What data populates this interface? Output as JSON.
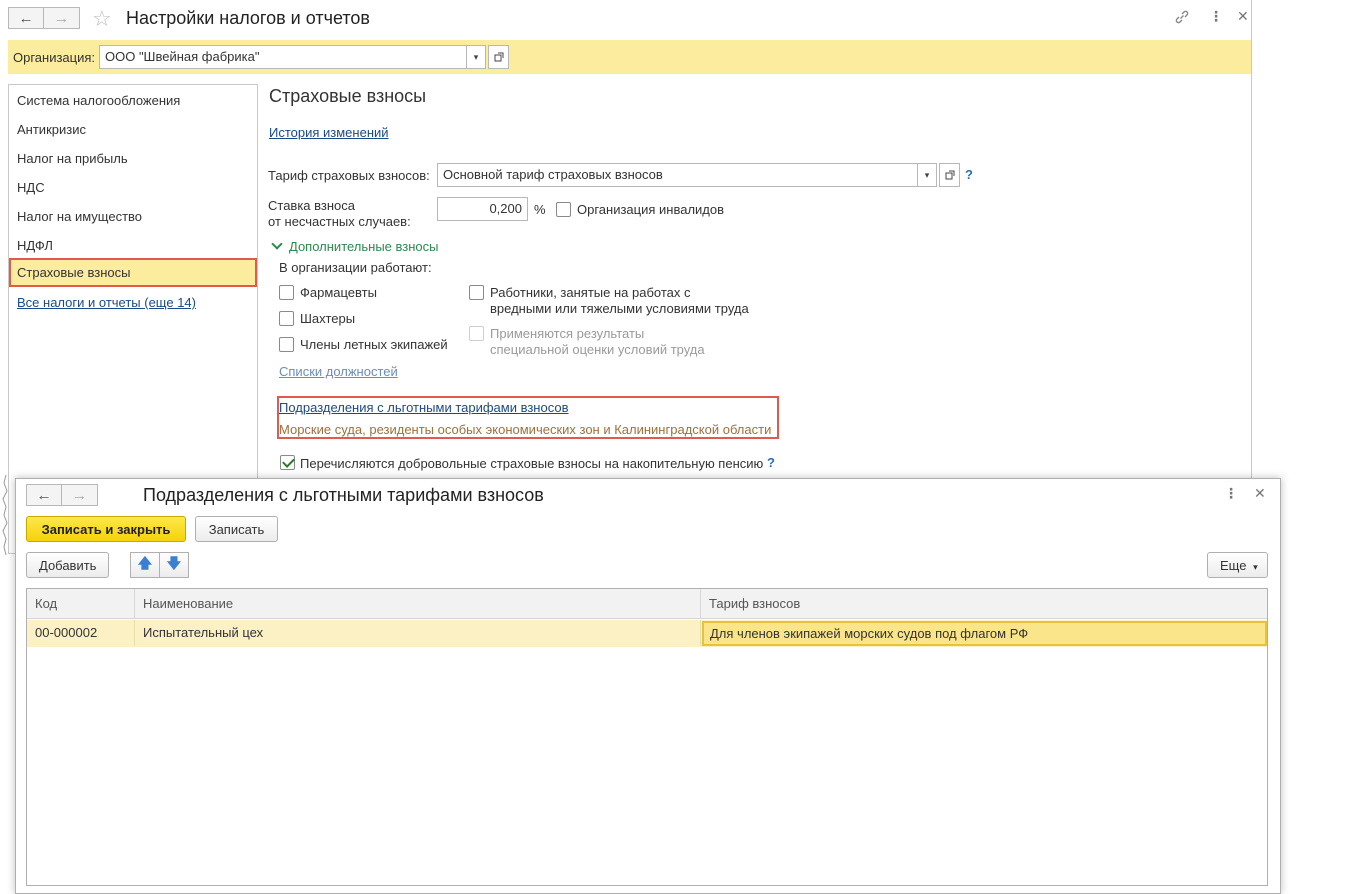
{
  "main_window": {
    "title": "Настройки налогов и отчетов",
    "org_label": "Организация:",
    "org_value": "ООО \"Швейная фабрика\""
  },
  "sidebar": {
    "items": [
      {
        "label": "Система налогообложения"
      },
      {
        "label": "Антикризис"
      },
      {
        "label": "Налог на прибыль"
      },
      {
        "label": "НДС"
      },
      {
        "label": "Налог на имущество"
      },
      {
        "label": "НДФЛ"
      },
      {
        "label": "Страховые взносы"
      }
    ],
    "more_link": "Все налоги и отчеты (еще 14)"
  },
  "content": {
    "heading": "Страховые взносы",
    "history_link": "История изменений",
    "tariff_label": "Тариф страховых взносов:",
    "tariff_value": "Основной тариф страховых взносов",
    "help_mark": "?",
    "rate_label_line1": "Ставка взноса",
    "rate_label_line2": "от несчастных случаев:",
    "rate_value": "0,200",
    "percent": "%",
    "disabled_org_label": "Организация инвалидов",
    "additional_section": "Дополнительные взносы",
    "employees_label": "В организации работают:",
    "cb_pharmacists": "Фармацевты",
    "cb_miners": "Шахтеры",
    "cb_crew": "Члены летных экипажей",
    "cb_hazard_line1": "Работники, занятые на работах с",
    "cb_hazard_line2": "вредными или тяжелыми условиями труда",
    "cb_assessment_line1": "Применяются результаты",
    "cb_assessment_line2": "специальной оценки условий труда",
    "positions_link": "Списки должностей",
    "divisions_link": "Подразделения с льготными тарифами взносов",
    "divisions_note": "Морские суда, резиденты особых экономических зон и Калининградской области",
    "voluntary_label": "Перечисляются добровольные страховые взносы на накопительную пенсию"
  },
  "dialog": {
    "title": "Подразделения с льготными тарифами взносов",
    "save_close": "Записать и закрыть",
    "save": "Записать",
    "add": "Добавить",
    "more": "Еще",
    "columns": [
      "Код",
      "Наименование",
      "Тариф взносов"
    ],
    "rows": [
      {
        "code": "00-000002",
        "name": "Испытательный цех",
        "tariff": "Для членов экипажей морских судов под флагом РФ"
      }
    ]
  },
  "colors": {
    "accent_yellow": "#fbec9e",
    "highlight_red": "#e05a4e",
    "link_blue": "#1a4a8a",
    "primary_button": "#f6d20a"
  },
  "state": {
    "disabled_org_checked": false,
    "voluntary_checked": true,
    "pharmacists_checked": false,
    "miners_checked": false,
    "crew_checked": false,
    "hazard_checked": false
  }
}
